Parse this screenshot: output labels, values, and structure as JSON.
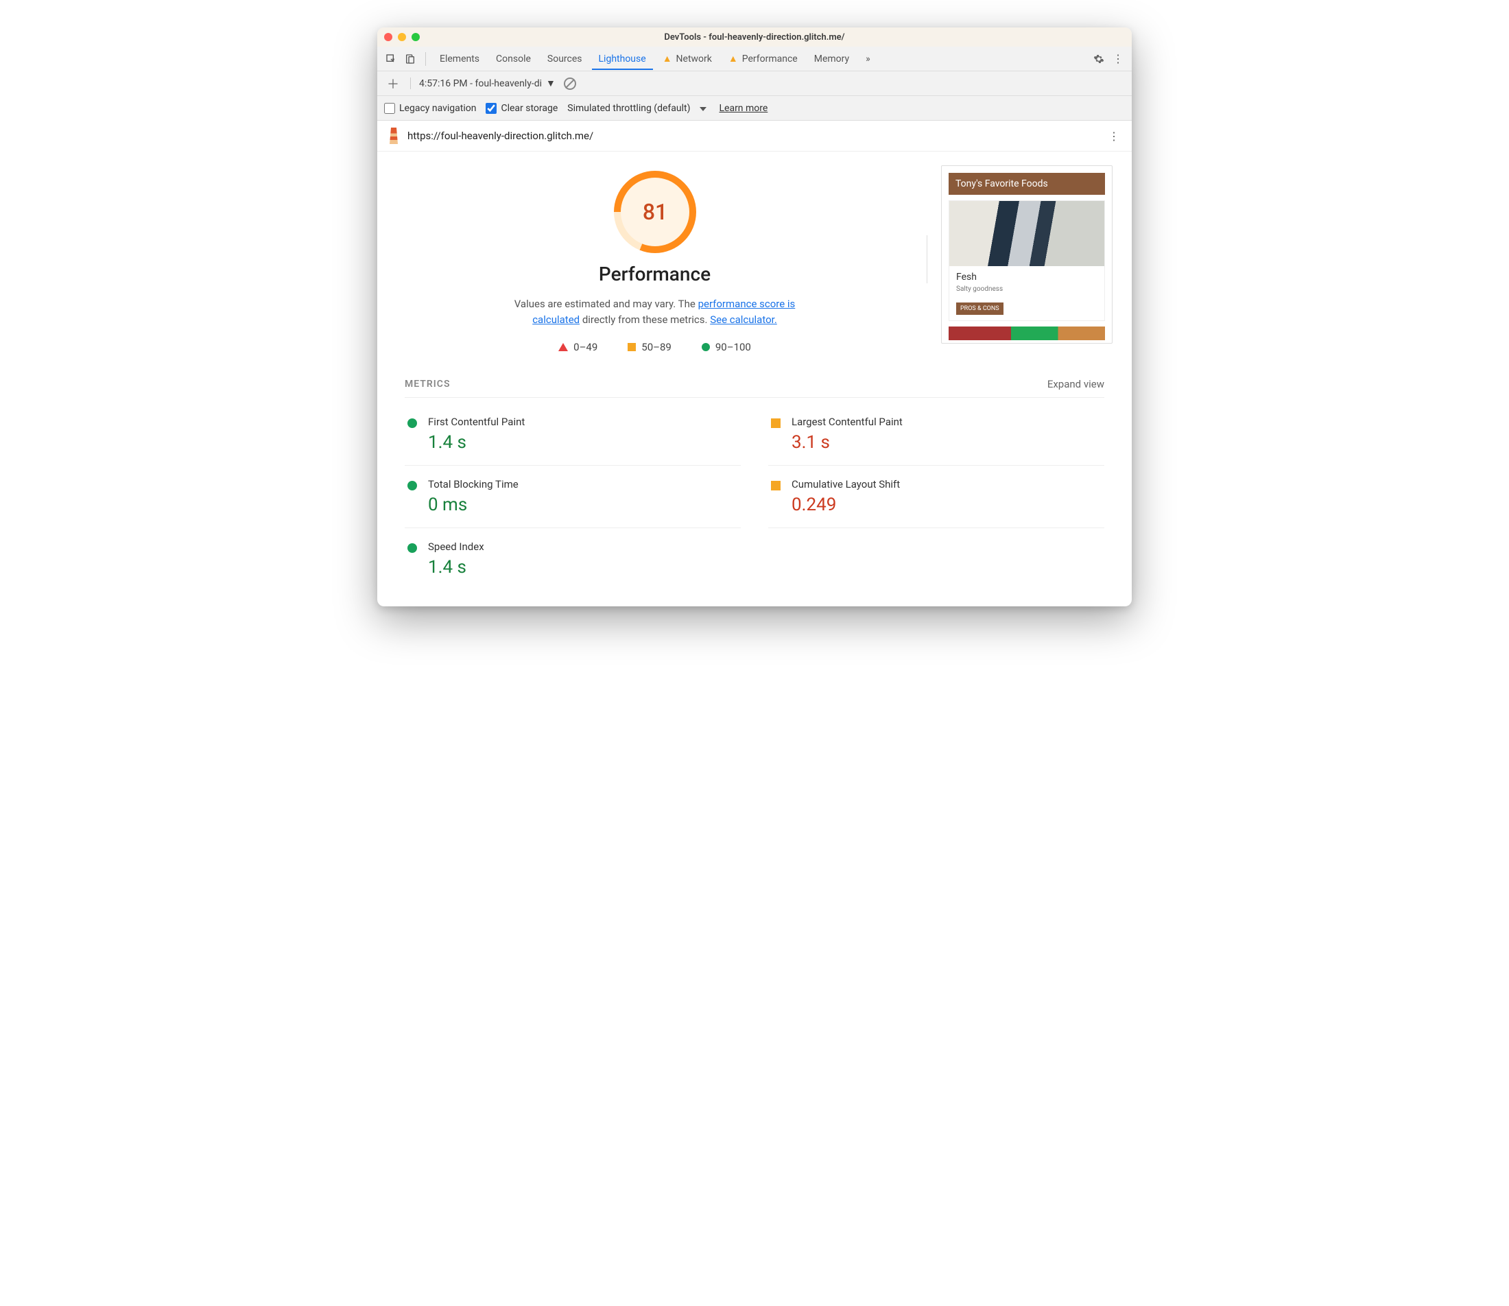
{
  "window": {
    "title": "DevTools - foul-heavenly-direction.glitch.me/"
  },
  "tabs": {
    "items": [
      "Elements",
      "Console",
      "Sources",
      "Lighthouse",
      "Network",
      "Performance",
      "Memory"
    ],
    "active": "Lighthouse",
    "warning_tabs": [
      "Network",
      "Performance"
    ]
  },
  "report_select": "4:57:16 PM - foul-heavenly-di",
  "options": {
    "legacy_label": "Legacy navigation",
    "legacy_checked": false,
    "clear_label": "Clear storage",
    "clear_checked": true,
    "throttling": "Simulated throttling (default)",
    "learn_more": "Learn more"
  },
  "url": "https://foul-heavenly-direction.glitch.me/",
  "gauge": {
    "score": "81",
    "label": "Performance",
    "desc_prefix": "Values are estimated and may vary. The ",
    "link1": "performance score is calculated",
    "desc_mid": " directly from these metrics. ",
    "link2": "See calculator."
  },
  "legend": {
    "low": "0–49",
    "mid": "50–89",
    "high": "90–100"
  },
  "preview": {
    "header": "Tony's Favorite Foods",
    "card_title": "Fesh",
    "card_sub": "Salty goodness",
    "card_btn": "PROS & CONS"
  },
  "metrics": {
    "title": "METRICS",
    "expand": "Expand view",
    "items": [
      {
        "name": "First Contentful Paint",
        "value": "1.4 s",
        "status": "green"
      },
      {
        "name": "Largest Contentful Paint",
        "value": "3.1 s",
        "status": "orange"
      },
      {
        "name": "Total Blocking Time",
        "value": "0 ms",
        "status": "green"
      },
      {
        "name": "Cumulative Layout Shift",
        "value": "0.249",
        "status": "orange"
      },
      {
        "name": "Speed Index",
        "value": "1.4 s",
        "status": "green"
      }
    ]
  }
}
